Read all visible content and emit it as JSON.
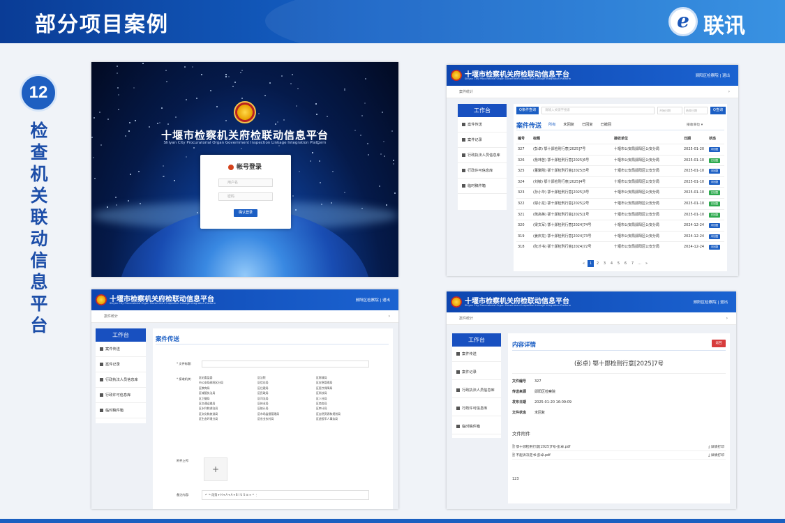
{
  "slide": {
    "title": "部分项目案例",
    "logo_text": "联讯",
    "logo_glyph": "e",
    "case_number": "12",
    "vertical_title": "检查机关联动信息平台"
  },
  "platform": {
    "name_cn": "十堰市检察机关府检联动信息平台",
    "name_en": "Shiyan City Procuratorial Organ Government Inspection Linkage Integration Platform",
    "user": "郧阳区检察院 | 退出"
  },
  "login": {
    "title": "帐号登录",
    "username_placeholder": "用户名",
    "password_placeholder": "密码",
    "submit_label": "确认登录"
  },
  "breadcrumb": "案件统计",
  "sidebar": {
    "header": "工作台",
    "items": [
      "案件传送",
      "案件记录",
      "行政执法人员信息库",
      "行政许可信息库",
      "临时稿件箱"
    ]
  },
  "list_view": {
    "search_button": "Q条件查询",
    "search_placeholder": "请输入关键字搜索",
    "date_start": "开始日期",
    "date_end": "结束日期",
    "query_button": "Q查询",
    "title": "案件传送",
    "tabs": [
      "所有",
      "未回复",
      "已回复",
      "已撤回"
    ],
    "filter_label": "接收单位 ▾",
    "columns": [
      "编号",
      "标题",
      "接收单位",
      "日期",
      "状态"
    ],
    "rows": [
      {
        "id": "327",
        "title": "(彭卓) 鄂十郧检刑行意[2025]7号",
        "unit": "十堰市公安局郧阳区公安分局",
        "date": "2025-01-20",
        "status": "未回复"
      },
      {
        "id": "326",
        "title": "(詹玮苦) 鄂十郧检刑行意[2025]6号",
        "unit": "十堰市公安局郧阳区公安分局",
        "date": "2025-01-10",
        "status": "已回复"
      },
      {
        "id": "325",
        "title": "(董聚刚) 鄂十郧检刑行意[2025]5号",
        "unit": "十堰市公安局郧阳区公安分局",
        "date": "2025-01-10",
        "status": "未回复"
      },
      {
        "id": "324",
        "title": "(刘敏) 鄂十郧检刑行意[2025]4号",
        "unit": "十堰市公安局郧阳区公安分局",
        "date": "2025-01-10",
        "status": "未回复"
      },
      {
        "id": "323",
        "title": "(孙小华) 鄂十郧检刑行意[2025]3号",
        "unit": "十堰市公安局郧阳区公安分局",
        "date": "2025-01-10",
        "status": "已回复"
      },
      {
        "id": "322",
        "title": "(鄢小龙) 鄂十郧检刑行意[2025]2号",
        "unit": "十堰市公安局郧阳区公安分局",
        "date": "2025-01-10",
        "status": "已回复"
      },
      {
        "id": "321",
        "title": "(熊高英) 鄂十郧检刑行意[2025]1号",
        "unit": "十堰市公安局郧阳区公安分局",
        "date": "2025-01-10",
        "status": "已回复"
      },
      {
        "id": "320",
        "title": "(梁文军) 鄂十郧检刑行意[2024]74号",
        "unit": "十堰市公安局郧阳区公安分局",
        "date": "2024-12-24",
        "status": "未回复"
      },
      {
        "id": "319",
        "title": "(姜庆龙) 鄂十郧检刑行意[2024]73号",
        "unit": "十堰市公安局郧阳区公安分局",
        "date": "2024-12-24",
        "status": "未回复"
      },
      {
        "id": "318",
        "title": "(阮才书) 鄂十郧检刑行意[2024]72号",
        "unit": "十堰市公安局郧阳区公安分局",
        "date": "2024-12-24",
        "status": "未回复"
      }
    ],
    "pager": [
      "«",
      "1",
      "2",
      "3",
      "4",
      "5",
      "6",
      "7",
      "…",
      "»"
    ]
  },
  "form_view": {
    "title": "案件传送",
    "field_title_label": "* 文件标题:",
    "field_org_label": "* 接收机关:",
    "orgs": [
      "区纪委监委",
      "区法院",
      "区财政局",
      "市公安局郧阳区分局",
      "区信访局",
      "区应急管理局",
      "区教育局",
      "区住建局",
      "区医疗保障局",
      "区城管执法局",
      "区民政局",
      "区科技局",
      "区卫健局",
      "区司法局",
      "区人社局",
      "区交通运输局",
      "区林业局",
      "区商务局",
      "区水利和湖泊局",
      "区统计局",
      "区审计局",
      "区文化和旅游局",
      "区市场监督管理局",
      "区自然资源和规划局",
      "区生态环境分局",
      "区农业农村局",
      "区退役军人事务局"
    ],
    "upload_label": "附件上传:",
    "upload_glyph": "+",
    "editor_label": "备注内容:",
    "editor_toolbar": "↶ ↷  段落 ▾   H ▾  A ▾  A ▾   B  I  U  S  ⊞  ≡  ❝  ⋮"
  },
  "detail_view": {
    "title": "内容详情",
    "back_button": "返回",
    "doc_heading": "(彭卓) 鄂十郧检刑行意[2025]7号",
    "fields": [
      {
        "label": "文件编号",
        "value": "327"
      },
      {
        "label": "传送来源",
        "value": "郧阳区检察院"
      },
      {
        "label": "发布日期",
        "value": "2025-01-20 16:09:09"
      },
      {
        "label": "文件状态",
        "value": "未回复"
      }
    ],
    "attachments_title": "文件附件",
    "attachments": [
      {
        "name": "🗎 鄂十郧检刑行意[2025]7号-彭卓.pdf",
        "action": "⤓ 详情打印"
      },
      {
        "name": "🗎 不起诉决定书-彭卓.pdf",
        "action": "⤓ 详情打印"
      }
    ],
    "footer_text": "123"
  },
  "colors": {
    "primary": "#1c5fc4",
    "header": "#1460c4",
    "replied": "#2eaa4f",
    "unreplied": "#1c5fc4",
    "back": "#d73c3c"
  }
}
